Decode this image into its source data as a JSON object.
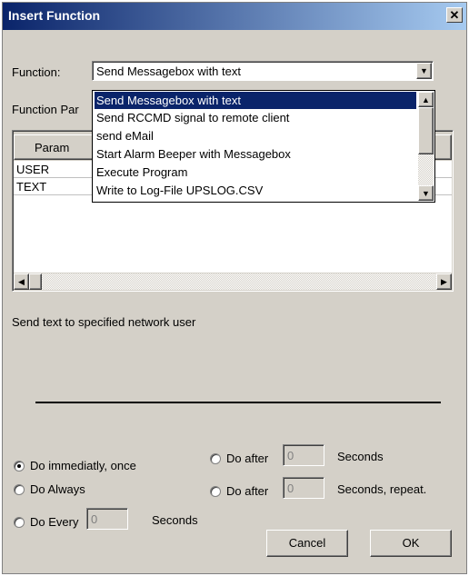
{
  "window": {
    "title": "Insert Function",
    "close": "✕"
  },
  "function": {
    "label": "Function:",
    "selected": "Send Messagebox with text",
    "options": [
      "Send Messagebox with text",
      "Send RCCMD signal to remote client",
      "send eMail",
      "Start Alarm Beeper with Messagebox",
      "Execute Program",
      "Write to Log-File UPSLOG.CSV"
    ]
  },
  "params": {
    "label": "Function Par",
    "header": "Param",
    "rows": [
      "USER",
      "TEXT"
    ]
  },
  "description": "Send text to specified network user",
  "schedule": {
    "immediately": "Do immediatly, once",
    "always": "Do Always",
    "every": "Do Every",
    "every_value": "0",
    "every_unit": "Seconds",
    "after": "Do after",
    "after_value": "0",
    "after_unit": "Seconds",
    "after_repeat": "Do after",
    "after_repeat_value": "0",
    "after_repeat_unit": "Seconds, repeat.",
    "selected": "immediately"
  },
  "buttons": {
    "cancel": "Cancel",
    "ok": "OK"
  },
  "colors": {
    "titlebar": "#0a246a",
    "selection": "#0a246a",
    "face": "#d4d0c8"
  },
  "icons": {
    "close": "close-icon",
    "dropdown": "chevron-down-icon"
  }
}
